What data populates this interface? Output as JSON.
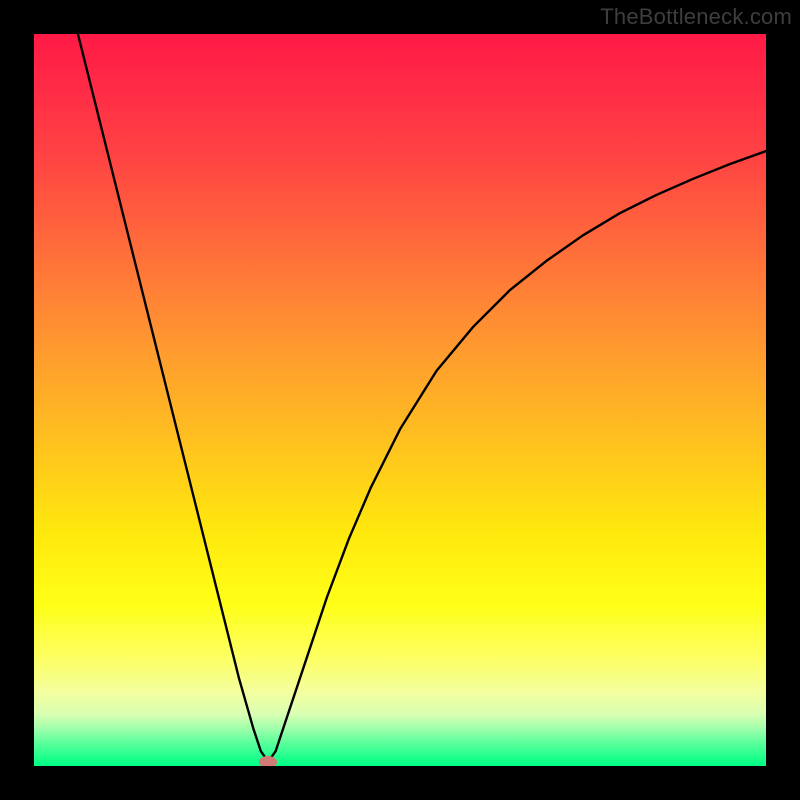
{
  "watermark": "TheBottleneck.com",
  "chart_data": {
    "type": "line",
    "title": "",
    "xlabel": "",
    "ylabel": "",
    "xlim": [
      0,
      100
    ],
    "ylim": [
      0,
      100
    ],
    "grid": false,
    "legend": false,
    "background_gradient": {
      "top_color": "#ff1a46",
      "mid_color": "#ffe80d",
      "bottom_color": "#00ff85"
    },
    "series": [
      {
        "name": "curve",
        "x": [
          6,
          8,
          10,
          12,
          14,
          16,
          18,
          20,
          22,
          24,
          26,
          28,
          30,
          31,
          32,
          33,
          34,
          36,
          38,
          40,
          43,
          46,
          50,
          55,
          60,
          65,
          70,
          75,
          80,
          85,
          90,
          95,
          100
        ],
        "y": [
          100,
          92,
          84,
          76,
          68,
          60,
          52,
          44,
          36,
          28,
          20,
          12,
          5,
          2,
          0.6,
          2,
          5,
          11,
          17,
          23,
          31,
          38,
          46,
          54,
          60,
          65,
          69,
          72.5,
          75.5,
          78,
          80.2,
          82.2,
          84
        ]
      }
    ],
    "marker": {
      "x": 32,
      "y": 0.6,
      "color": "#d07c76"
    }
  }
}
